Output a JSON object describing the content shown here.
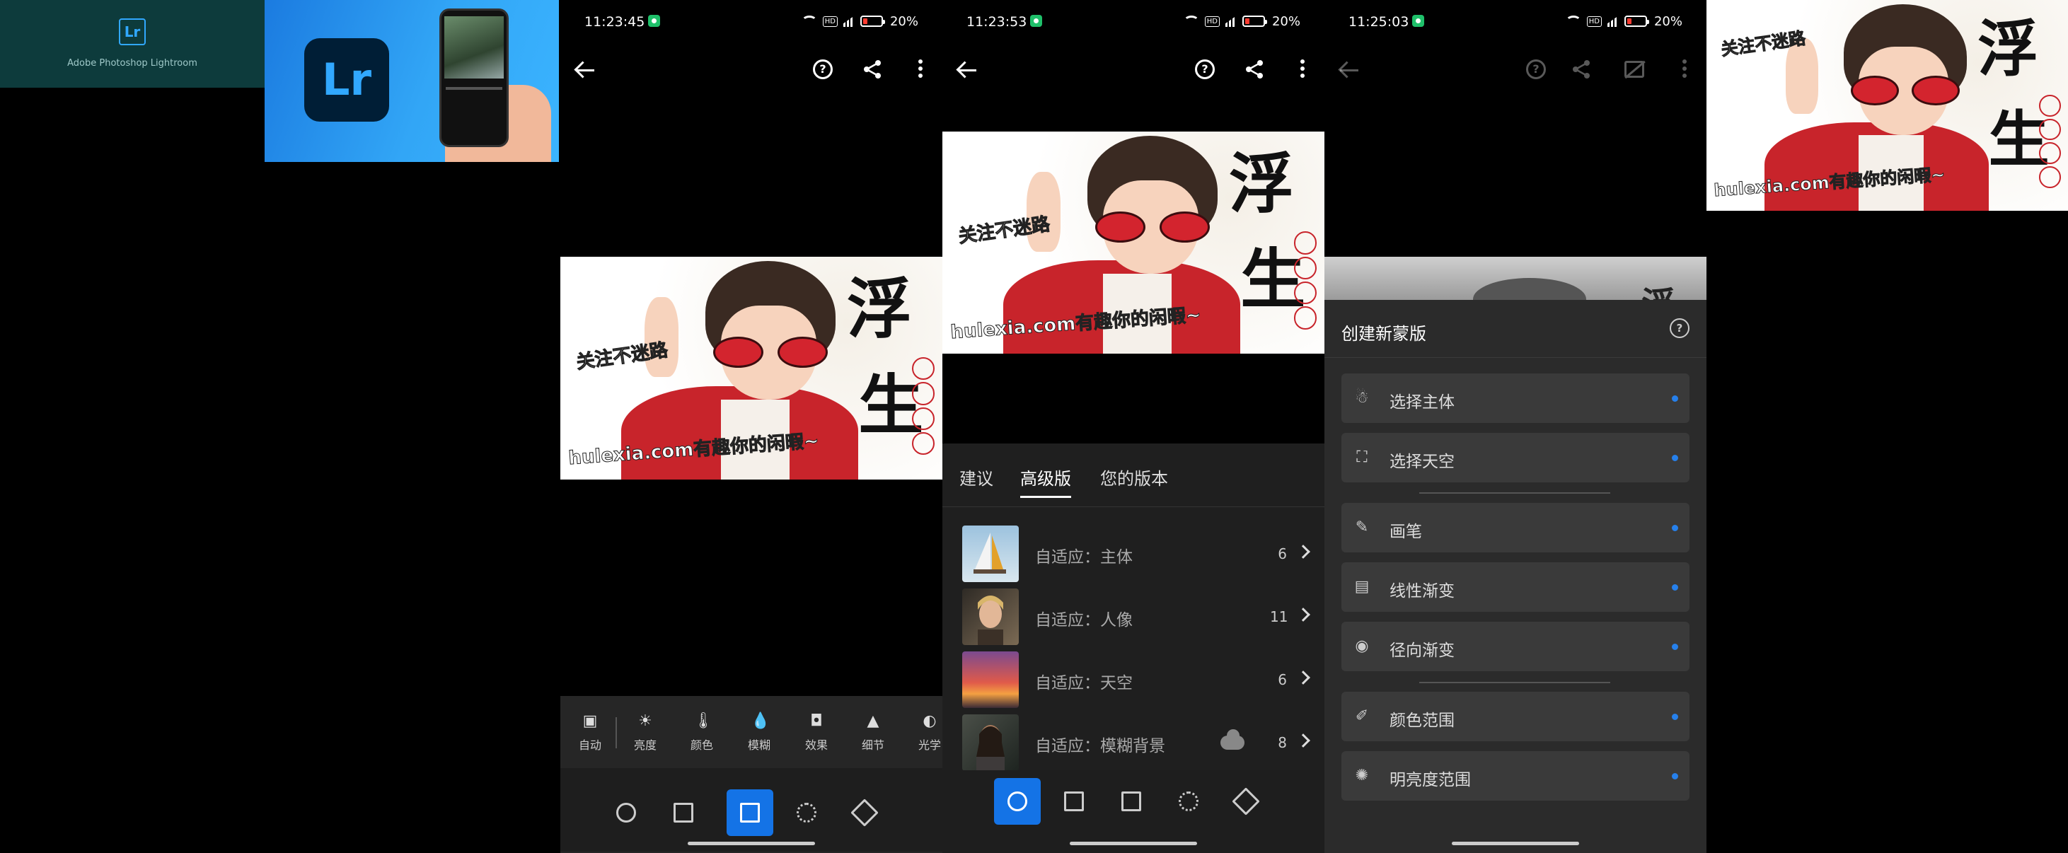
{
  "promo": {
    "app_name": "Adobe Photoshop Lightroom",
    "logo_text": "Lr"
  },
  "artwork": {
    "title_char_1": "浮",
    "title_char_2": "生",
    "left_text": "关注不迷路",
    "bottom_text": "hulexia.com有趣你的闲暇~"
  },
  "screen1": {
    "status": {
      "time": "11:23:45",
      "battery": "20%"
    },
    "tools": [
      {
        "label": "自动",
        "icon": "auto-icon"
      },
      {
        "label": "亮度",
        "icon": "brightness-icon"
      },
      {
        "label": "颜色",
        "icon": "thermometer-icon"
      },
      {
        "label": "模糊",
        "icon": "drop-icon"
      },
      {
        "label": "效果",
        "icon": "vignette-icon"
      },
      {
        "label": "细节",
        "icon": "triangle-icon"
      },
      {
        "label": "光学",
        "icon": "lens-icon"
      }
    ]
  },
  "screen2": {
    "status": {
      "time": "11:23:53",
      "battery": "20%"
    },
    "tabs": [
      "建议",
      "高级版",
      "您的版本"
    ],
    "active_tab": "高级版",
    "presets": [
      {
        "label": "自适应：主体",
        "count": "6",
        "thumb": "sailboat"
      },
      {
        "label": "自适应：人像",
        "count": "11",
        "thumb": "portrait"
      },
      {
        "label": "自适应：天空",
        "count": "6",
        "thumb": "sunset"
      },
      {
        "label": "自适应：模糊背景",
        "count": "8",
        "thumb": "person",
        "cloud": true
      }
    ]
  },
  "screen3": {
    "status": {
      "time": "11:25:03",
      "battery": "20%"
    },
    "panel_title": "创建新蒙版",
    "groups": [
      [
        {
          "label": "选择主体",
          "icon": "subject-icon"
        },
        {
          "label": "选择天空",
          "icon": "sky-icon"
        }
      ],
      [
        {
          "label": "画笔",
          "icon": "brush-icon"
        },
        {
          "label": "线性渐变",
          "icon": "linear-gradient-icon"
        },
        {
          "label": "径向渐变",
          "icon": "radial-gradient-icon"
        }
      ],
      [
        {
          "label": "颜色范围",
          "icon": "color-range-icon"
        },
        {
          "label": "明亮度范围",
          "icon": "luminance-range-icon"
        }
      ]
    ]
  },
  "colors": {
    "accent": "#1473e6",
    "dot": "#2680eb",
    "battery_low": "#ff3b30",
    "panel": "#2b2b2b"
  }
}
